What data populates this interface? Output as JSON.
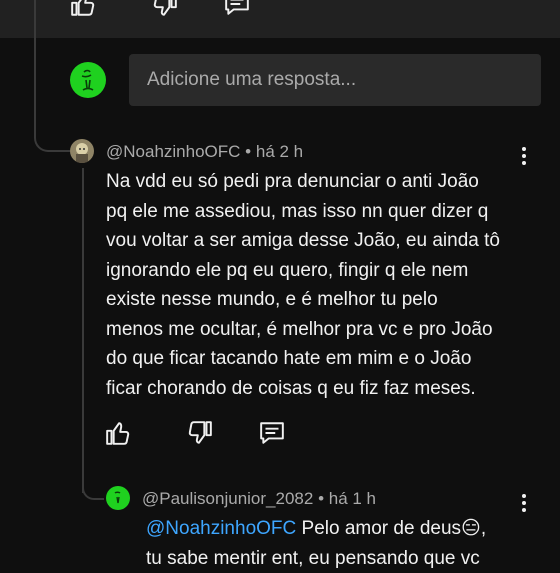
{
  "reply_prompt": {
    "placeholder": "Adicione uma resposta..."
  },
  "comment": {
    "author": "@NoahzinhoOFC",
    "time": "há 2 h",
    "lines": [
      "Na vdd eu só pedi pra denunciar o anti João",
      "pq ele me assediou, mas isso nn quer dizer q",
      "vou voltar a ser amiga desse João, eu ainda tô",
      "ignorando ele pq eu quero, fingir q ele nem",
      "existe nesse mundo, e é melhor tu pelo",
      "menos me ocultar, é melhor pra vc e pro João",
      "do que ficar tacando hate em mim e o João",
      "ficar chorando de coisas q eu fiz faz meses."
    ]
  },
  "reply": {
    "author": "@Paulisonjunior_2082",
    "time": "há 1 h",
    "mention": "@NoahzinhoOFC",
    "line1_text": "Pelo amor de deus😑,",
    "line2_text": "tu sabe mentir ent, eu pensando que vc"
  },
  "meta_separator": "•",
  "colors": {
    "background": "#0f0f0f",
    "accent_link": "#3ea6ff",
    "avatar_green": "#1fd11f"
  },
  "icons": [
    "like-icon",
    "dislike-icon",
    "reply-icon",
    "more-vert-icon"
  ]
}
